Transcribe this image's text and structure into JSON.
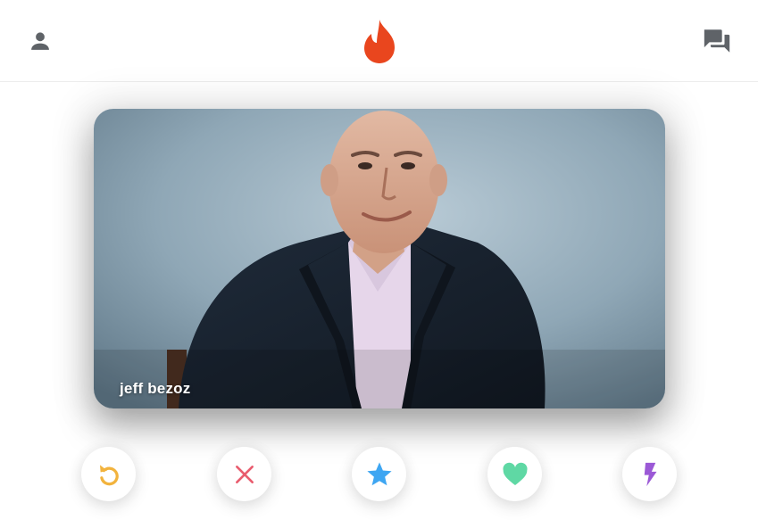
{
  "header": {
    "profile_icon": "person-icon",
    "logo_icon": "flame-logo-icon",
    "messages_icon": "chat-bubbles-icon"
  },
  "card": {
    "name": "jeff bezoz"
  },
  "actions": [
    {
      "name": "rewind",
      "icon": "rewind-icon",
      "color": "#F2B33D"
    },
    {
      "name": "nope",
      "icon": "close-icon",
      "color": "#E95C6E"
    },
    {
      "name": "super-like",
      "icon": "star-icon",
      "color": "#3EA6F2"
    },
    {
      "name": "like",
      "icon": "heart-icon",
      "color": "#5FD8A4"
    },
    {
      "name": "boost",
      "icon": "lightning-icon",
      "color": "#9B59D6"
    }
  ],
  "colors": {
    "brand": "#E9461E",
    "header_icons": "#5f6368"
  }
}
